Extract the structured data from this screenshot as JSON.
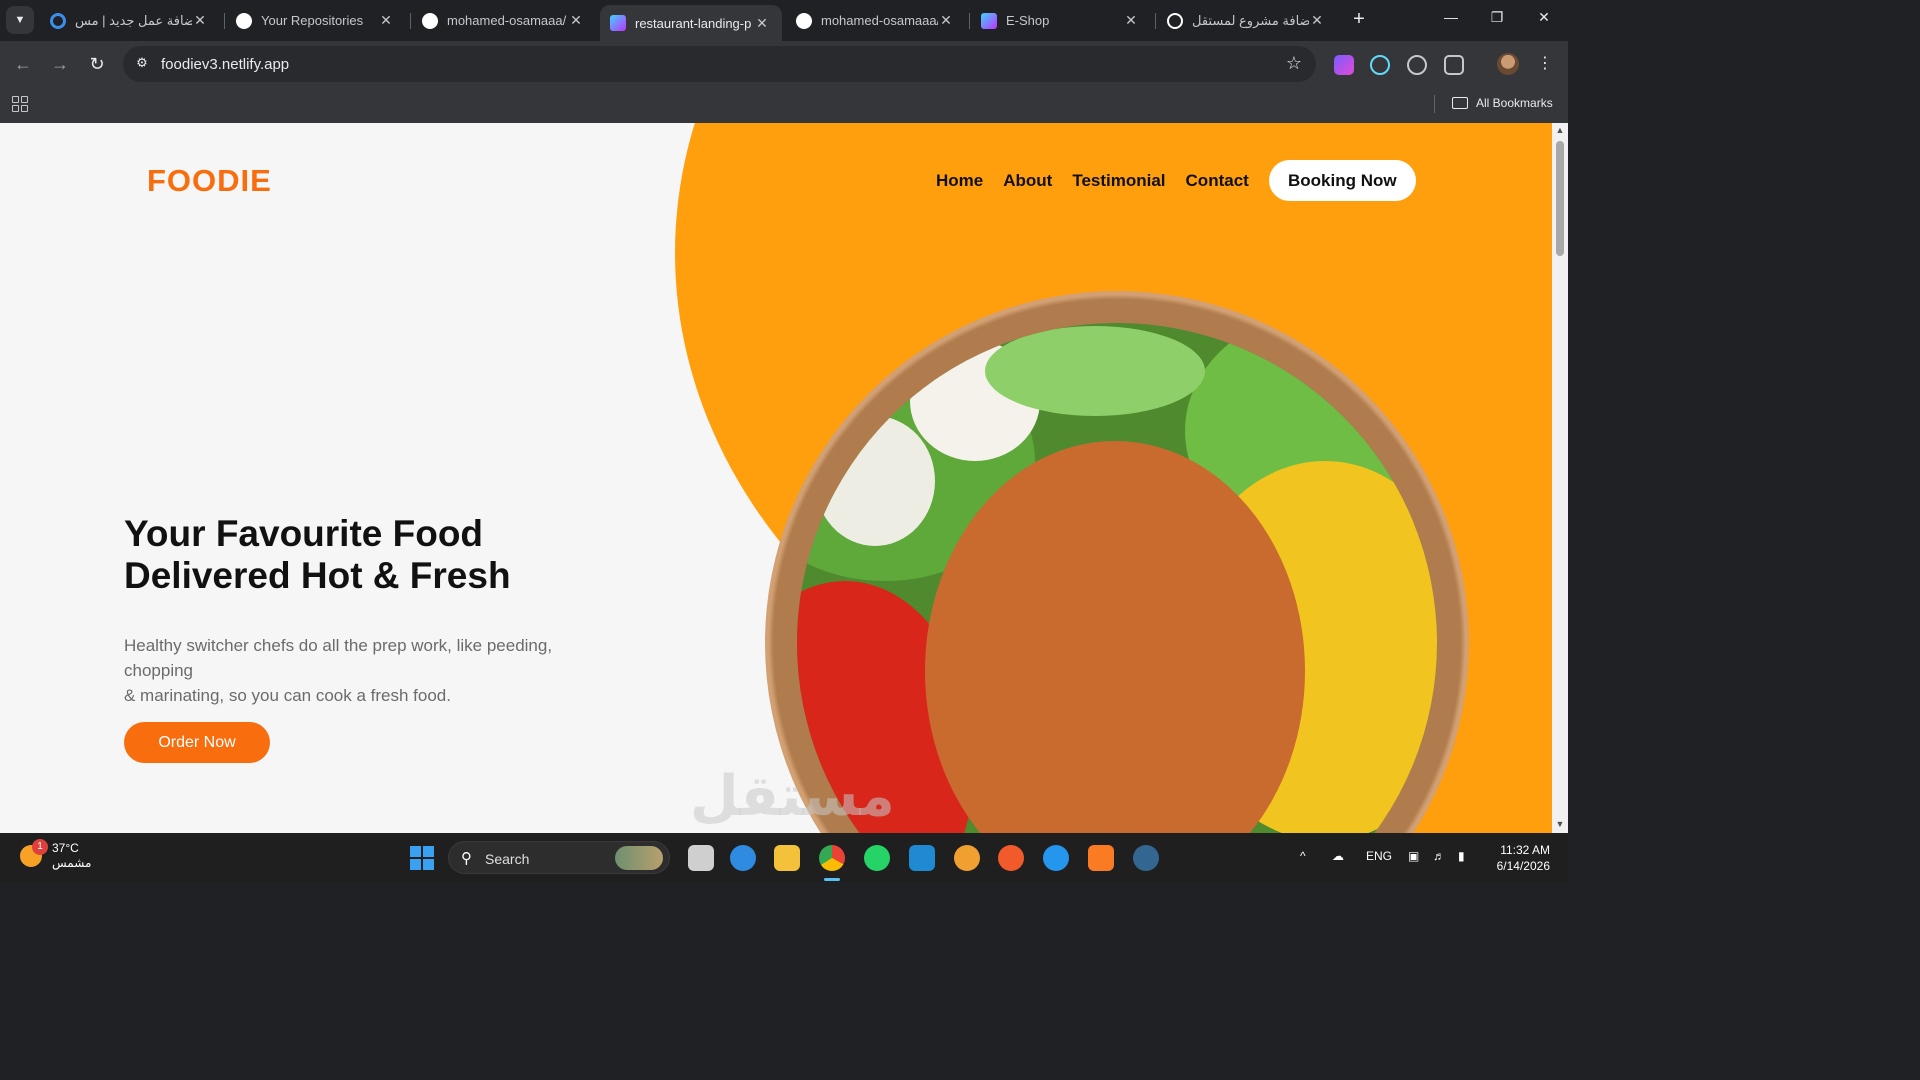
{
  "browser": {
    "tabs": [
      {
        "title": "إضافة عمل جديد | مس",
        "favicon": "ring-favicon",
        "color": "#3b8eea"
      },
      {
        "title": "Your Repositories",
        "favicon": "github-icon",
        "color": "#ffffff"
      },
      {
        "title": "mohamed-osamaaa/",
        "favicon": "github-icon",
        "color": "#ffffff"
      },
      {
        "title": "restaurant-landing-p",
        "favicon": "vite-icon",
        "color": "#bd34fe",
        "active": true
      },
      {
        "title": "mohamed-osamaaa/",
        "favicon": "github-icon",
        "color": "#ffffff"
      },
      {
        "title": "E-Shop",
        "favicon": "vite-icon",
        "color": "#bd34fe"
      },
      {
        "title": "إضافة مشروع لمستقل",
        "favicon": "openai-icon",
        "color": "#ffffff"
      }
    ],
    "url": "foodiev3.netlify.app",
    "bookmarks_label": "All Bookmarks"
  },
  "site": {
    "logo": "FOODIE",
    "nav": [
      "Home",
      "About",
      "Testimonial",
      "Contact"
    ],
    "booking_label": "Booking Now",
    "hero_title_line1": "Your Favourite Food",
    "hero_title_line2": "Delivered Hot & Fresh",
    "hero_text_line1": "Healthy switcher chefs do all the prep work, like peeding, chopping",
    "hero_text_line2": "& marinating, so you can cook a fresh food.",
    "order_label": "Order Now",
    "colors": {
      "accent": "#f86e0f",
      "blob": "#ff9f0d",
      "background": "#f6f6f6"
    }
  },
  "watermark": "مستقل",
  "taskbar": {
    "temperature": "37°C",
    "condition": "مشمس",
    "notification_count": "1",
    "search_label": "Search",
    "language": "ENG",
    "time": "11:32 AM",
    "date": "6/14/2026"
  }
}
